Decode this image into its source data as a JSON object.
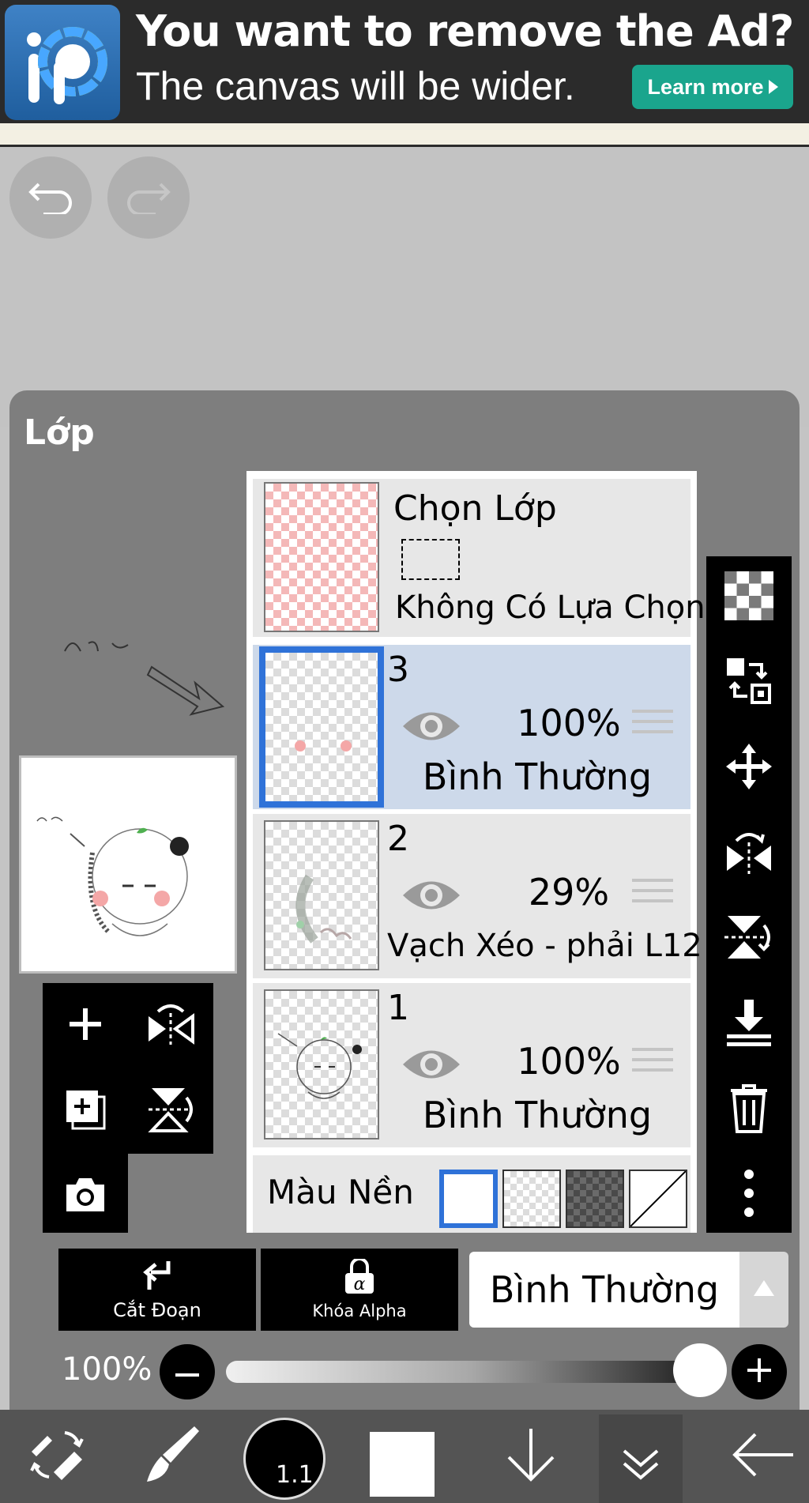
{
  "ad": {
    "headline": "You want to remove the Ad?",
    "subline": "The canvas will be wider.",
    "cta": "Learn more",
    "accent": "#1aa58d"
  },
  "history": {
    "undo_icon": "undo-arrow-icon",
    "redo_icon": "redo-arrow-icon"
  },
  "panel": {
    "title": "Lớp"
  },
  "selection_layer": {
    "title": "Chọn Lớp",
    "status": "Không Có Lựa Chọn"
  },
  "layers": [
    {
      "number": "3",
      "opacity": "100%",
      "blend": "Bình Thường",
      "selected": true
    },
    {
      "number": "2",
      "opacity": "29%",
      "blend": "Vạch Xéo - phải L12",
      "selected": false
    },
    {
      "number": "1",
      "opacity": "100%",
      "blend": "Bình Thường",
      "selected": false
    }
  ],
  "background": {
    "label": "Màu Nền",
    "options": [
      "white",
      "transparent",
      "dark-checker",
      "none"
    ],
    "selected": "white"
  },
  "actions": {
    "clipping": "Cắt Đoạn",
    "alpha_lock": "Khóa Alpha",
    "blend_mode": "Bình Thường"
  },
  "opacity_slider": {
    "label": "100%",
    "value": 1.0
  },
  "bottom_nav": {
    "brush_size": "1.1",
    "selected_color": "#ffffff"
  },
  "colors": {
    "selection_blue": "#2f72d8",
    "selected_row": "#cdd9ea",
    "panel_gray": "#7e7e7e"
  }
}
